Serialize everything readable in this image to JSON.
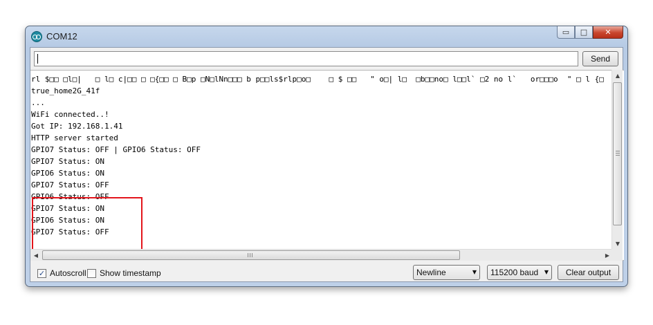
{
  "window": {
    "title": "COM12",
    "minimize_label": "▭",
    "maximize_label": "□",
    "close_label": "✕"
  },
  "input": {
    "value": "",
    "send_label": "Send"
  },
  "output": {
    "lines": [
      "rl $□□ □l□|   □ l□ c|□□ □ □{□□ □ B□p □N□lNn□□□ b p□□ls$rlp□o□    □ $ □□   \" o□| l□  □b□□no□ l□□l` □2 no l`   or□□□o  \" □ l {□",
      "true_home2G_41f",
      "...",
      "WiFi connected..!",
      "Got IP: 192.168.1.41",
      "HTTP server started",
      "GPIO7 Status: OFF | GPIO6 Status: OFF",
      "GPIO7 Status: ON",
      "GPIO6 Status: ON",
      "GPIO7 Status: OFF",
      "GPIO6 Status: OFF",
      "GPIO7 Status: ON",
      "GPIO6 Status: ON",
      "GPIO7 Status: OFF"
    ]
  },
  "scrollbars": {
    "up_arrow": "▲",
    "down_arrow": "▼",
    "left_arrow": "◀",
    "right_arrow": "▶"
  },
  "bottom": {
    "autoscroll_label": "Autoscroll",
    "autoscroll_checked": true,
    "autoscroll_mark": "✓",
    "timestamp_label": "Show timestamp",
    "timestamp_checked": false,
    "line_ending": "Newline",
    "baud_rate": "115200 baud",
    "dropdown_arrow": "▼",
    "clear_label": "Clear output"
  },
  "colors": {
    "highlight_box": "#e3141b",
    "close_button": "#c9462e"
  },
  "icons": {
    "app": "arduino-icon",
    "checkbox_checked": "checkmark-icon"
  }
}
